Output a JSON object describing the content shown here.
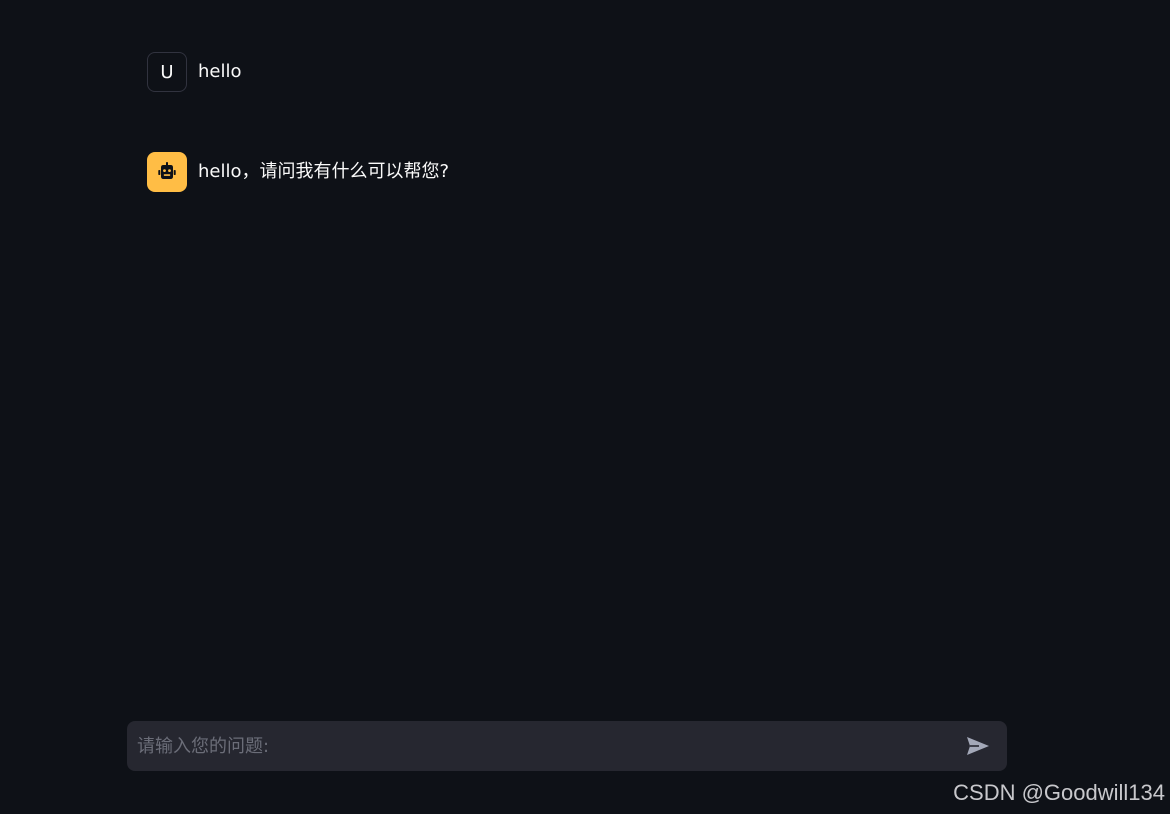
{
  "chat": {
    "messages": [
      {
        "role": "user",
        "avatar_label": "U",
        "text": "hello"
      },
      {
        "role": "assistant",
        "avatar_icon": "robot-icon",
        "text": "hello，请问我有什么可以帮您?"
      }
    ]
  },
  "input": {
    "placeholder": "请输入您的问题:",
    "value": "",
    "send_icon": "send-icon"
  },
  "watermark": {
    "text": "CSDN @Goodwill134"
  },
  "colors": {
    "background": "#0e1117",
    "input_background": "#262730",
    "bot_avatar": "#ffbd45",
    "text": "#fafafa",
    "placeholder": "#6b6d78"
  }
}
